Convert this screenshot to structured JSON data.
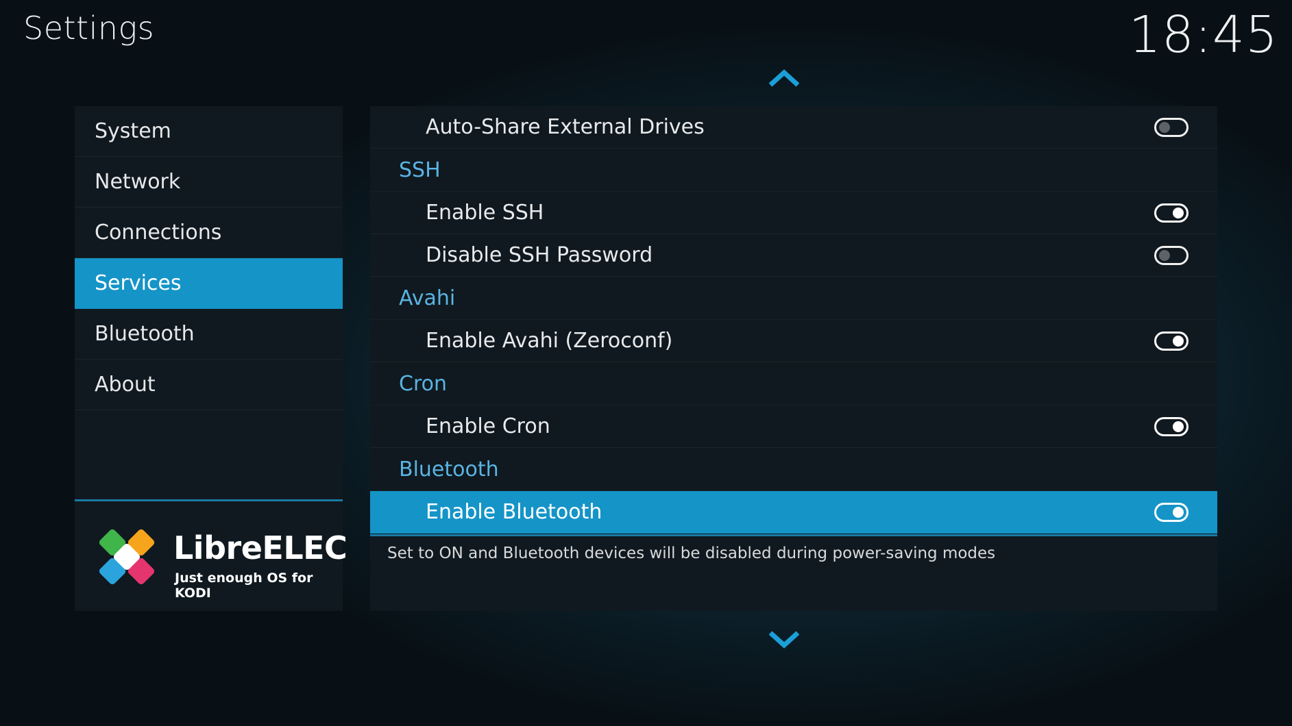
{
  "header": {
    "title": "Settings",
    "clock": "18:45"
  },
  "sidebar": {
    "items": [
      {
        "label": "System",
        "active": false
      },
      {
        "label": "Network",
        "active": false
      },
      {
        "label": "Connections",
        "active": false
      },
      {
        "label": "Services",
        "active": true
      },
      {
        "label": "Bluetooth",
        "active": false
      },
      {
        "label": "About",
        "active": false
      }
    ]
  },
  "logo": {
    "name": "LibreELEC",
    "tagline": "Just enough OS for KODI"
  },
  "settings": {
    "rows": [
      {
        "type": "setting",
        "label": "Auto-Share External Drives",
        "state": "off"
      },
      {
        "type": "category",
        "label": "SSH"
      },
      {
        "type": "setting",
        "label": "Enable SSH",
        "state": "on"
      },
      {
        "type": "setting",
        "label": "Disable SSH Password",
        "state": "off"
      },
      {
        "type": "category",
        "label": "Avahi"
      },
      {
        "type": "setting",
        "label": "Enable Avahi (Zeroconf)",
        "state": "on"
      },
      {
        "type": "category",
        "label": "Cron"
      },
      {
        "type": "setting",
        "label": "Enable Cron",
        "state": "on"
      },
      {
        "type": "category",
        "label": "Bluetooth"
      },
      {
        "type": "setting",
        "label": "Enable Bluetooth",
        "state": "on",
        "focused": true
      }
    ],
    "description": "Set to ON and Bluetooth devices will be disabled during power-saving modes"
  },
  "colors": {
    "accent": "#1594c7",
    "category": "#5ab4e3",
    "panel": "#10191f"
  },
  "icons": {
    "scroll_up": "chevron-up-icon",
    "scroll_down": "chevron-down-icon"
  }
}
